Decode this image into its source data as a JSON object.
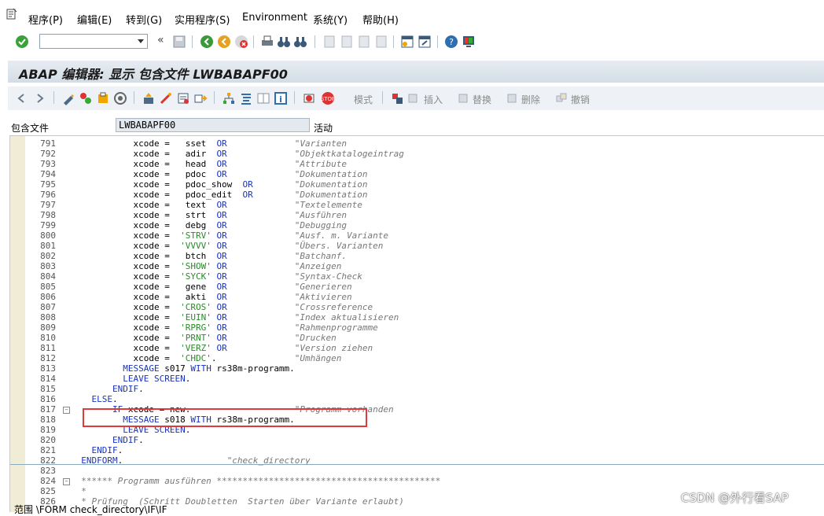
{
  "menu": {
    "items": [
      "程序(P)",
      "编辑(E)",
      "转到(G)",
      "实用程序(S)",
      "Environment",
      "系统(Y)",
      "帮助(H)"
    ]
  },
  "toolbar": {
    "command_field_value": ""
  },
  "title": "ABAP 编辑器: 显示 包含文件 LWBABAPF00",
  "app_toolbar": {
    "mode_label": "模式",
    "insert_label": "插入",
    "replace_label": "替换",
    "delete_label": "删除",
    "undo_label": "撤销"
  },
  "include_field": {
    "label": "包含文件",
    "value": "LWBABAPF00",
    "status": "活动"
  },
  "code_lines": [
    {
      "n": "791",
      "code": "            xcode =   sset  OR             \"Varianten"
    },
    {
      "n": "792",
      "code": "            xcode =   adir  OR             \"Objektkatalogeintrag"
    },
    {
      "n": "793",
      "code": "            xcode =   head  OR             \"Attribute"
    },
    {
      "n": "794",
      "code": "            xcode =   pdoc  OR             \"Dokumentation"
    },
    {
      "n": "795",
      "code": "            xcode =   pdoc_show  OR        \"Dokumentation"
    },
    {
      "n": "796",
      "code": "            xcode =   pdoc_edit  OR        \"Dokumentation"
    },
    {
      "n": "797",
      "code": "            xcode =   text  OR             \"Textelemente"
    },
    {
      "n": "798",
      "code": "            xcode =   strt  OR             \"Ausführen"
    },
    {
      "n": "799",
      "code": "            xcode =   debg  OR             \"Debugging"
    },
    {
      "n": "800",
      "code": "            xcode =  'STRV' OR             \"Ausf. m. Variante"
    },
    {
      "n": "801",
      "code": "            xcode =  'VVVV' OR             \"Übers. Varianten"
    },
    {
      "n": "802",
      "code": "            xcode =   btch  OR             \"Batchanf."
    },
    {
      "n": "803",
      "code": "            xcode =  'SHOW' OR             \"Anzeigen"
    },
    {
      "n": "804",
      "code": "            xcode =  'SYCK' OR             \"Syntax-Check"
    },
    {
      "n": "805",
      "code": "            xcode =   gene  OR             \"Generieren"
    },
    {
      "n": "806",
      "code": "            xcode =   akti  OR             \"Aktivieren"
    },
    {
      "n": "807",
      "code": "            xcode =  'CROS' OR             \"Crossreference"
    },
    {
      "n": "808",
      "code": "            xcode =  'EUIN' OR             \"Index aktualisieren"
    },
    {
      "n": "809",
      "code": "            xcode =  'RPRG' OR             \"Rahmenprogramme"
    },
    {
      "n": "810",
      "code": "            xcode =  'PRNT' OR             \"Drucken"
    },
    {
      "n": "811",
      "code": "            xcode =  'VERZ' OR             \"Version ziehen"
    },
    {
      "n": "812",
      "code": "            xcode =  'CHDC'.               \"Umhängen"
    },
    {
      "n": "813",
      "code": "          MESSAGE s017 WITH rs38m-programm."
    },
    {
      "n": "814",
      "code": "          LEAVE SCREEN."
    },
    {
      "n": "815",
      "code": "        ENDIF."
    },
    {
      "n": "816",
      "code": "    ELSE."
    },
    {
      "n": "817",
      "code": "        IF xcode = new.                    \"Programm vorhanden"
    },
    {
      "n": "818",
      "code": "          MESSAGE s018 WITH rs38m-programm."
    },
    {
      "n": "819",
      "code": "          LEAVE SCREEN."
    },
    {
      "n": "820",
      "code": "        ENDIF."
    },
    {
      "n": "821",
      "code": "    ENDIF."
    },
    {
      "n": "822",
      "code": "  ENDFORM.                    \"check_directory"
    },
    {
      "n": "823",
      "code": ""
    },
    {
      "n": "824",
      "code": "  ****** Programm ausführen *******************************************"
    },
    {
      "n": "825",
      "code": "  *"
    },
    {
      "n": "826",
      "code": "  * Prüfung  (Schritt Doubletten  Starten über Variante erlaubt)"
    }
  ],
  "statusbar": {
    "scope": "范围 \\FORM check_directory\\IF\\IF"
  },
  "watermark": "CSDN @外行看SAP",
  "colors": {
    "keyword": "#1a33b8",
    "string": "#2a8a2a",
    "comment": "#777777",
    "highlight_box": "#e0393e",
    "gutter": "#f0ecd6"
  }
}
